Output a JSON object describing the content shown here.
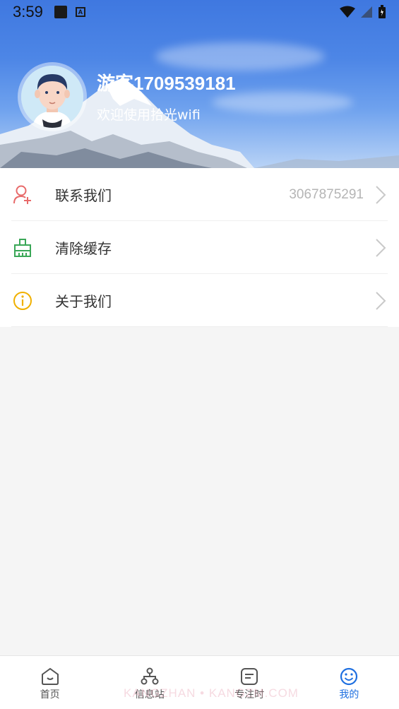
{
  "status_bar": {
    "time": "3:59",
    "icons": [
      "notification-square-icon",
      "a-badge-icon",
      "wifi-icon",
      "signal-icon",
      "battery-icon"
    ]
  },
  "profile": {
    "username": "游客1709539181",
    "welcome": "欢迎使用拾光wifi"
  },
  "menu": {
    "items": [
      {
        "label": "联系我们",
        "value": "3067875291",
        "icon": "contact-add-user-icon",
        "icon_color": "#e86a6a"
      },
      {
        "label": "清除缓存",
        "value": "",
        "icon": "broom-clear-icon",
        "icon_color": "#3aa757"
      },
      {
        "label": "关于我们",
        "value": "",
        "icon": "info-icon",
        "icon_color": "#f0b000"
      }
    ]
  },
  "bottom_nav": {
    "items": [
      {
        "label": "首页",
        "icon": "home-icon",
        "active": false
      },
      {
        "label": "信息站",
        "icon": "sitemap-icon",
        "active": false
      },
      {
        "label": "专注时",
        "icon": "note-icon",
        "active": false
      },
      {
        "label": "我的",
        "icon": "smiley-icon",
        "active": true
      }
    ]
  },
  "watermark": "KANGZHAN • KANGZM.COM",
  "colors": {
    "accent": "#1e6fe0",
    "background": "#f5f5f5"
  }
}
